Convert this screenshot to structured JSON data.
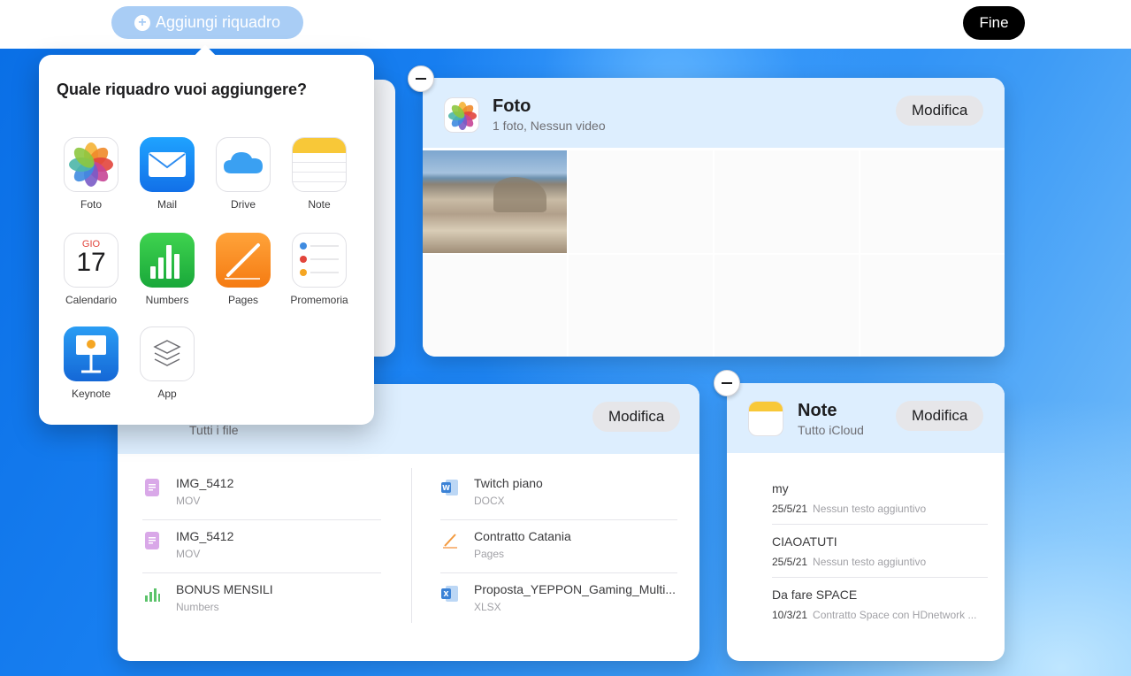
{
  "topbar": {
    "add_tile_label": "Aggiungi riquadro",
    "done_label": "Fine"
  },
  "popover": {
    "title": "Quale riquadro vuoi aggiungere?",
    "apps": [
      {
        "label": "Foto",
        "icon": "photos-icon"
      },
      {
        "label": "Mail",
        "icon": "mail-icon"
      },
      {
        "label": "Drive",
        "icon": "icloud-drive-icon"
      },
      {
        "label": "Note",
        "icon": "notes-icon"
      },
      {
        "label": "Calendario",
        "icon": "calendar-icon",
        "month": "GIO",
        "day": "17"
      },
      {
        "label": "Numbers",
        "icon": "numbers-icon"
      },
      {
        "label": "Pages",
        "icon": "pages-icon"
      },
      {
        "label": "Promemoria",
        "icon": "reminders-icon"
      },
      {
        "label": "Keynote",
        "icon": "keynote-icon"
      },
      {
        "label": "App",
        "icon": "app-stack-icon"
      }
    ]
  },
  "foto_widget": {
    "title": "Foto",
    "subtitle": "1 foto, Nessun video",
    "edit_label": "Modifica"
  },
  "drive_widget": {
    "subtitle": "Tutti i file",
    "edit_label": "Modifica",
    "left_files": [
      {
        "name": "IMG_5412",
        "type": "MOV",
        "icon": "document-icon"
      },
      {
        "name": "IMG_5412",
        "type": "MOV",
        "icon": "document-icon"
      },
      {
        "name": "BONUS MENSILI",
        "type": "Numbers",
        "icon": "numbers-file-icon"
      }
    ],
    "right_files": [
      {
        "name": "Twitch piano",
        "type": "DOCX",
        "icon": "word-file-icon"
      },
      {
        "name": "Contratto Catania",
        "type": "Pages",
        "icon": "pages-file-icon"
      },
      {
        "name": "Proposta_YEPPON_Gaming_Multi...",
        "type": "XLSX",
        "icon": "excel-file-icon"
      }
    ]
  },
  "note_widget": {
    "title": "Note",
    "subtitle": "Tutto iCloud",
    "edit_label": "Modifica",
    "notes": [
      {
        "title": "my",
        "date": "25/5/21",
        "preview": "Nessun testo aggiuntivo"
      },
      {
        "title": "CIAOATUTI",
        "date": "25/5/21",
        "preview": "Nessun testo aggiuntivo"
      },
      {
        "title": "Da fare SPACE",
        "date": "10/3/21",
        "preview": "Contratto Space con HDnetwork ..."
      }
    ]
  },
  "colors": {
    "accent": "#0a6fe6",
    "widget_header": "#ddeefe",
    "add_button": "#a9cdf5"
  }
}
